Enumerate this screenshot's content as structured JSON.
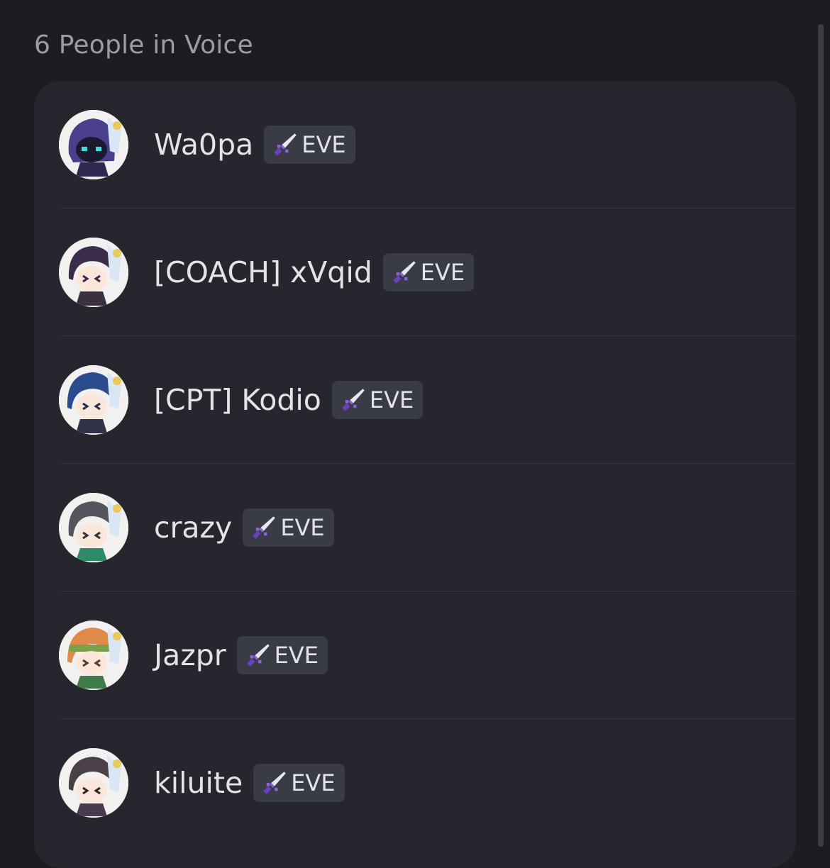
{
  "header": {
    "title": "6 People in Voice"
  },
  "participants": [
    {
      "name": "Wa0pa",
      "badge": "EVE",
      "avatar_icon": "chibi-hooded-avatar-icon",
      "hair_color": "#4a3f8c"
    },
    {
      "name": "[COACH] xVqid",
      "badge": "EVE",
      "avatar_icon": "chibi-avatar-icon",
      "hair_color": "#3a2d4a"
    },
    {
      "name": "[CPT] Kodio",
      "badge": "EVE",
      "avatar_icon": "chibi-avatar-icon",
      "hair_color": "#2a4b8e"
    },
    {
      "name": "crazy",
      "badge": "EVE",
      "avatar_icon": "chibi-avatar-icon",
      "hair_color": "#55555e"
    },
    {
      "name": "Jazpr",
      "badge": "EVE",
      "avatar_icon": "chibi-avatar-icon",
      "hair_color": "#e08a4a"
    },
    {
      "name": "kiluite",
      "badge": "EVE",
      "avatar_icon": "chibi-avatar-icon",
      "hair_color": "#4a4048"
    }
  ],
  "colors": {
    "background": "#1c1d22",
    "panel": "#26272e",
    "badge": "#393b45",
    "text": "#e3e4ea",
    "heading": "#9b9ca6",
    "sword_blade": "#8c63d8"
  }
}
